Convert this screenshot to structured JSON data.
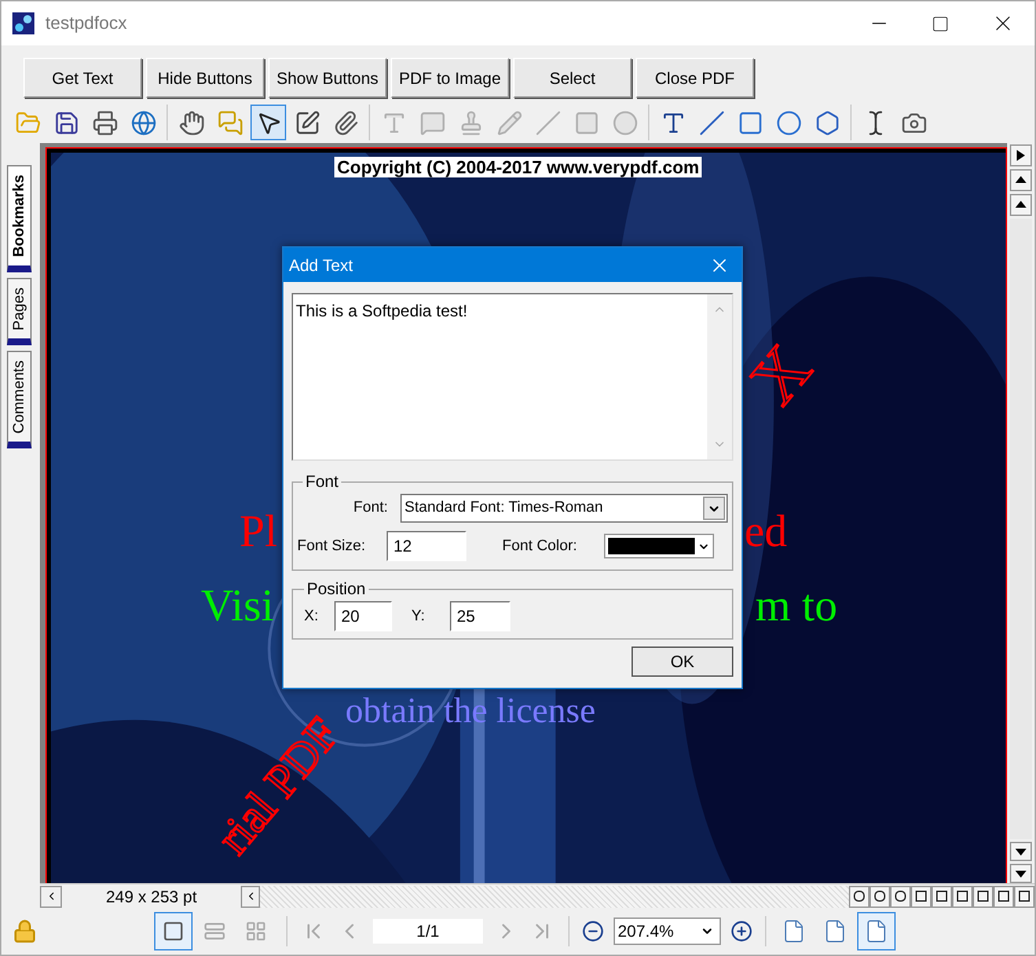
{
  "window": {
    "title": "testpdfocx"
  },
  "buttons": [
    "Get Text",
    "Hide Buttons",
    "Show Buttons",
    "PDF to Image",
    "Select",
    "Close PDF"
  ],
  "toolbar": [
    [
      {
        "kind": "open",
        "selected": false,
        "disabled": false
      },
      {
        "kind": "save",
        "selected": false,
        "disabled": false
      },
      {
        "kind": "print",
        "selected": false,
        "disabled": false
      },
      {
        "kind": "email",
        "selected": false,
        "disabled": false
      }
    ],
    [
      {
        "kind": "hand",
        "selected": false,
        "disabled": false
      },
      {
        "kind": "comments",
        "selected": false,
        "disabled": false
      },
      {
        "kind": "select",
        "selected": true,
        "disabled": false
      },
      {
        "kind": "edit",
        "selected": false,
        "disabled": false
      },
      {
        "kind": "attach",
        "selected": false,
        "disabled": false
      }
    ],
    [
      {
        "kind": "textbox",
        "selected": false,
        "disabled": true
      },
      {
        "kind": "note",
        "selected": false,
        "disabled": true
      },
      {
        "kind": "stamp",
        "selected": false,
        "disabled": true
      },
      {
        "kind": "pencil",
        "selected": false,
        "disabled": true
      },
      {
        "kind": "line",
        "selected": false,
        "disabled": true
      },
      {
        "kind": "rect",
        "selected": false,
        "disabled": true
      },
      {
        "kind": "ellipse",
        "selected": false,
        "disabled": true
      }
    ],
    [
      {
        "kind": "textbox",
        "selected": false,
        "disabled": false
      },
      {
        "kind": "line",
        "selected": false,
        "disabled": false
      },
      {
        "kind": "rect",
        "selected": false,
        "disabled": false
      },
      {
        "kind": "ellipse",
        "selected": false,
        "disabled": false
      },
      {
        "kind": "polygon",
        "selected": false,
        "disabled": false
      }
    ],
    [
      {
        "kind": "textselect",
        "selected": false,
        "disabled": false
      },
      {
        "kind": "snapshot",
        "selected": false,
        "disabled": false
      }
    ]
  ],
  "side_tabs": [
    {
      "label": "Bookmarks",
      "selected": true
    },
    {
      "label": "Pages",
      "selected": false
    },
    {
      "label": "Comments",
      "selected": false
    }
  ],
  "page": {
    "copyright": "Copyright (C) 2004-2017 www.verypdf.com",
    "red_left": "Pl",
    "red_right": "ed",
    "green_left": "Visi",
    "green_right": "m to",
    "blue": "obtain the license",
    "diagonal": "rial PDF",
    "diagonal_top": "X"
  },
  "dialog": {
    "title": "Add Text",
    "text": "This is a Softpedia test!",
    "font_group": "Font",
    "font_label": "Font:",
    "font_value": "Standard Font: Times-Roman",
    "size_label": "Font Size:",
    "size_value": "12",
    "color_label": "Font Color:",
    "color": "#000000",
    "position_group": "Position",
    "x_label": "X:",
    "x_value": "20",
    "y_label": "Y:",
    "y_value": "25",
    "ok": "OK"
  },
  "status": {
    "size": "249 x 253 pt"
  },
  "footer": {
    "views": [
      {
        "kind": "single",
        "selected": true,
        "disabled": false
      },
      {
        "kind": "continuous",
        "selected": false,
        "disabled": true
      },
      {
        "kind": "facing",
        "selected": false,
        "disabled": true
      }
    ],
    "page": "1/1",
    "zoom": "207.4%",
    "fits": [
      {
        "selected": false
      },
      {
        "selected": false
      },
      {
        "selected": true
      }
    ]
  }
}
